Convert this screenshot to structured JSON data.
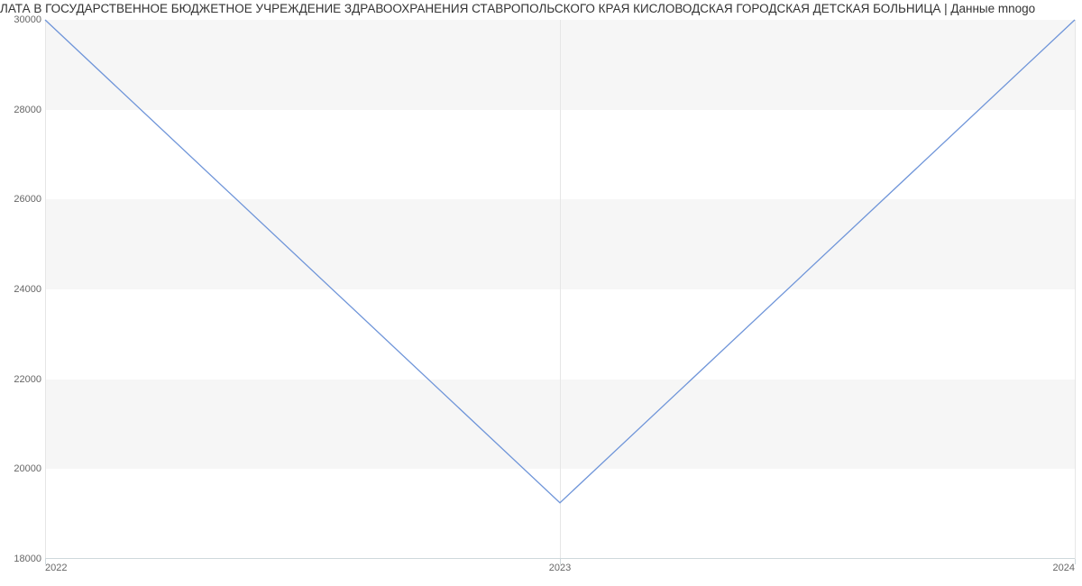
{
  "chart_data": {
    "type": "line",
    "title": "ЛАТА В ГОСУДАРСТВЕННОЕ БЮДЖЕТНОЕ УЧРЕЖДЕНИЕ ЗДРАВООХРАНЕНИЯ СТАВРОПОЛЬСКОГО КРАЯ КИСЛОВОДСКАЯ ГОРОДСКАЯ ДЕТСКАЯ БОЛЬНИЦА | Данные mnogo",
    "x": [
      "2022",
      "2023",
      "2024"
    ],
    "values": [
      30000,
      19250,
      30000
    ],
    "xlabel": "",
    "ylabel": "",
    "y_ticks": [
      18000,
      20000,
      22000,
      24000,
      26000,
      28000,
      30000
    ],
    "ylim": [
      18000,
      30000
    ],
    "line_color": "#6f95d9"
  }
}
